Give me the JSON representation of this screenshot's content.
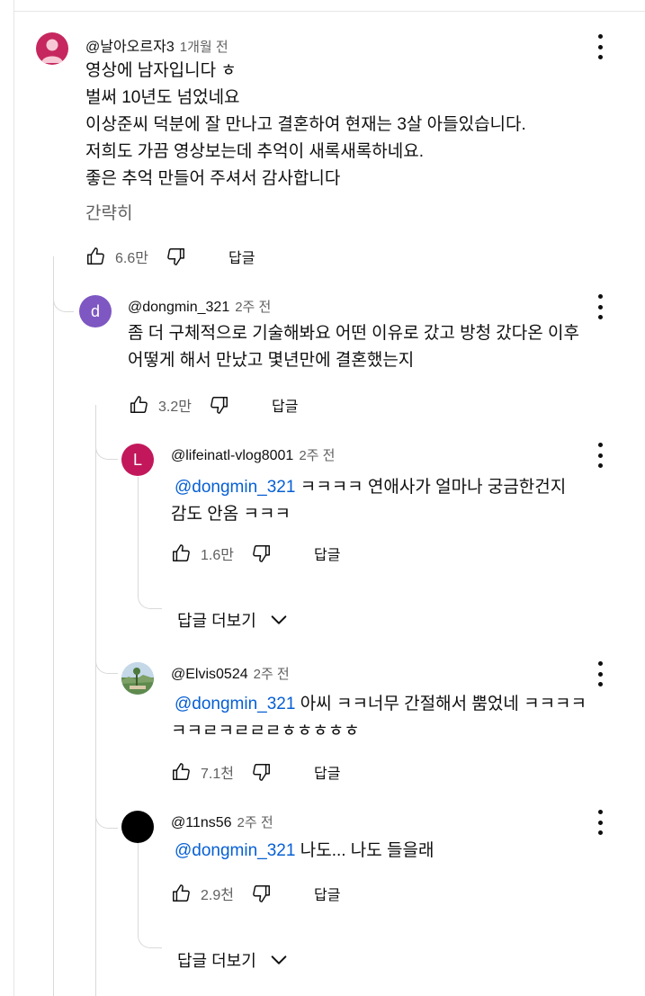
{
  "comments": {
    "top": {
      "author": "@날아오르자3",
      "time": "1개월 전",
      "lines": [
        "영상에 남자입니다 ㅎ",
        "벌써 10년도 넘었네요",
        "이상준씨 덕분에 잘 만나고 결혼하여 현재는 3살 아들있습니다.",
        "저희도 가끔 영상보는데 추억이 새록새록하네요.",
        "좋은 추억 만들어 주셔서 감사합니다"
      ],
      "collapse_label": "간략히",
      "likes": "6.6만",
      "reply_label": "답글",
      "avatar_color": "#c6275f"
    },
    "reply1": {
      "author": "@dongmin_321",
      "time": "2주 전",
      "lines": [
        "좀 더 구체적으로 기술해봐요 어떤 이유로 갔고 방청 갔다온 이후",
        "어떻게 해서 만났고 몇년만에 결혼했는지"
      ],
      "likes": "3.2만",
      "reply_label": "답글",
      "avatar_letter": "d",
      "avatar_color": "#7e57c2"
    },
    "reply2": {
      "author": "@lifeinatl-vlog8001",
      "time": "2주 전",
      "mention": "@dongmin_321",
      "line1_rest": "  ㅋㅋㅋㅋ 연애사가 얼마나 궁금한건지",
      "line2": "감도 안옴 ㅋㅋㅋ",
      "likes": "1.6만",
      "reply_label": "답글",
      "avatar_letter": "L",
      "avatar_color": "#c2185b"
    },
    "more_replies_1": "답글 더보기",
    "reply3": {
      "author": "@Elvis0524",
      "time": "2주 전",
      "mention": "@dongmin_321",
      "line1_rest": " 아씨 ㅋㅋ너무 간절해서 뿜었네 ㅋㅋㅋㅋ",
      "line2": "ㅋㅋㄹㅋㄹㄹㄹㅎㅎㅎㅎㅎ",
      "likes": "7.1천",
      "reply_label": "답글"
    },
    "reply4": {
      "author": "@11ns56",
      "time": "2주 전",
      "mention": "@dongmin_321",
      "line1_rest": " 나도... 나도 들을래",
      "likes": "2.9천",
      "reply_label": "답글",
      "avatar_color": "#000000"
    },
    "more_replies_2": "답글 더보기"
  },
  "icons": {
    "like": "thumbs-up-icon",
    "dislike": "thumbs-down-icon",
    "menu": "more-vert-icon",
    "expand": "chevron-down-icon"
  }
}
